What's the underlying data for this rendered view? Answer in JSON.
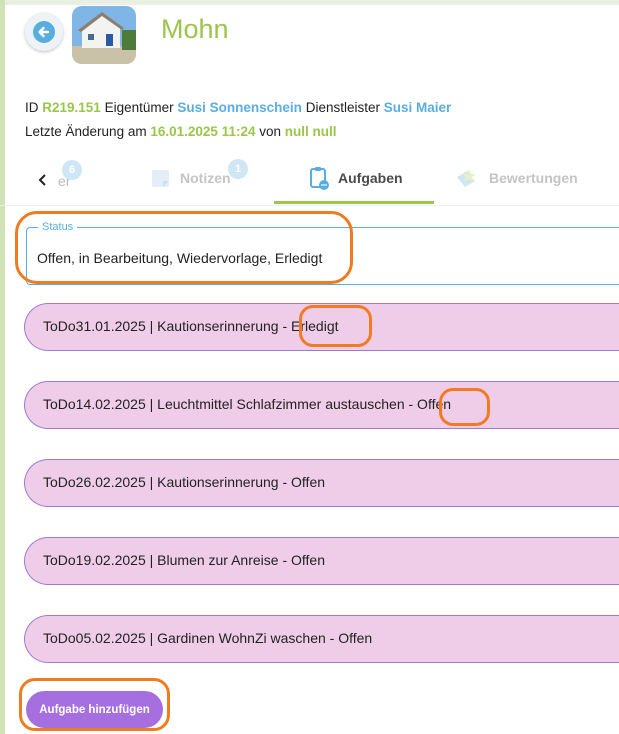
{
  "header": {
    "title": "Mohn"
  },
  "info": {
    "id_label": "ID",
    "id_value": "R219.151",
    "owner_label": "Eigentümer",
    "owner_value": "Susi Sonnenschein",
    "provider_label": "Dienstleister",
    "provider_value": "Susi Maier",
    "changed_label": "Letzte Änderung am",
    "changed_value": "16.01.2025 11:24",
    "by_label": "von",
    "by_value": "null null"
  },
  "tabs": {
    "partial_label": "er",
    "partial_badge": "6",
    "items": [
      {
        "label": "Notizen",
        "badge": "1",
        "icon": "note-icon"
      },
      {
        "label": "Aufgaben",
        "badge": "",
        "icon": "clipboard-icon"
      },
      {
        "label": "Bewertungen",
        "badge": "",
        "icon": "rating-icon"
      }
    ],
    "active": "Aufgaben"
  },
  "status_filter": {
    "legend": "Status",
    "value": "Offen, in Bearbeitung, Wiedervorlage, Erledigt"
  },
  "todos": [
    {
      "text": "ToDo31.01.2025 | Kautionserinnerung - Erledigt"
    },
    {
      "text": "ToDo14.02.2025 | Leuchtmittel Schlafzimmer austauschen - Offen"
    },
    {
      "text": "ToDo26.02.2025 | Kautionserinnerung - Offen"
    },
    {
      "text": "ToDo19.02.2025 | Blumen zur Anreise - Offen"
    },
    {
      "text": "ToDo05.02.2025 | Gardinen WohnZi waschen - Offen"
    }
  ],
  "actions": {
    "add_label": "Aufgabe hinzufügen"
  },
  "colors": {
    "accent_green": "#9cc54b",
    "accent_blue": "#5aaedf",
    "todo_bg": "#efcde8",
    "todo_border": "#9c7ad6",
    "button_purple": "#a66fe0",
    "highlight_orange": "#f07c22"
  }
}
